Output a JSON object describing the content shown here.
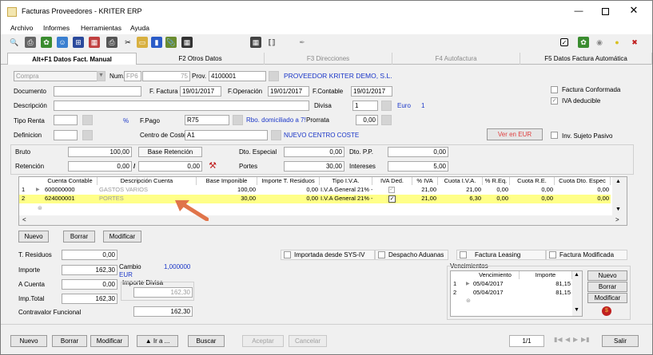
{
  "window": {
    "title": "Facturas Proveedores - KRITER ERP"
  },
  "menu": [
    "Archivo",
    "Informes",
    "Herramientas",
    "Ayuda"
  ],
  "tabs": [
    "Alt+F1 Datos Fact. Manual",
    "F2 Otros Datos",
    "F3 Direcciones",
    "F4 Autofactura",
    "F5 Datos Factura Automática"
  ],
  "header": {
    "tipo": "Compra",
    "num_label": "Num.",
    "num_serie": "FP6",
    "num_value": "75",
    "prov_label": "Prov.",
    "prov_code": "4100001",
    "prov_name": "PROVEEDOR KRITER DEMO, S.L.",
    "documento_label": "Documento",
    "f_factura_label": "F. Factura",
    "f_factura": "19/01/2017",
    "f_operacion_label": "F.Operación",
    "f_operacion": "19/01/2017",
    "f_contable_label": "F.Contable",
    "f_contable": "19/01/2017",
    "descripcion_label": "Descripción",
    "divisa_label": "Divisa",
    "divisa_value": "1",
    "divisa_name": "Euro",
    "divisa_rate": "1",
    "tipo_renta_label": "Tipo Renta",
    "pct": "%",
    "fpago_label": "F.Pago",
    "fpago_code": "R75",
    "fpago_name": "Rbo. domiciliado a 75 días",
    "prorrata_label": "Prorrata",
    "prorrata_value": "0,00",
    "definicion_label": "Definicion",
    "centro_label": "Centro de Coste",
    "centro_code": "A1",
    "centro_name": "NUEVO CENTRO COSTE",
    "ver_eur_button": "Ver en EUR",
    "factura_conformada": "Factura Conformada",
    "iva_deducible": "IVA deducible",
    "inv_sujeto_pasivo": "Inv. Sujeto Pasivo"
  },
  "totals": {
    "bruto_label": "Bruto",
    "bruto": "100,00",
    "base_retencion_label": "Base Retención",
    "retencion_label": "Retención",
    "retencion_pct": "0,00",
    "retencion_base": "0,00",
    "dto_especial_label": "Dto. Especial",
    "dto_especial": "0,00",
    "dto_pp_label": "Dto. P.P.",
    "dto_pp": "0,00",
    "portes_label": "Portes",
    "portes": "30,00",
    "intereses_label": "Intereses",
    "intereses": "5,00"
  },
  "lines_grid": {
    "columns": [
      "Cuenta Contable",
      "Descripción Cuenta",
      "Base Imponible",
      "Importe T. Residuos",
      "Tipo I.V.A.",
      "IVA Ded.",
      "% IVA",
      "Cuota I.V.A.",
      "% R.Eq.",
      "Cuota R.E.",
      "Cuota Dto. Espec"
    ],
    "rows": [
      {
        "n": "1",
        "cuenta": "600000000",
        "desc": "GASTOS VARIOS",
        "base": "100,00",
        "residuos": "0,00",
        "tipo": "I.V.A General 21% -",
        "pct_iva": "21,00",
        "cuota_iva": "21,00",
        "pct_req": "0,00",
        "cuota_re": "0,00",
        "dto": "0,00"
      },
      {
        "n": "2",
        "cuenta": "624000001",
        "desc": "PORTES",
        "base": "30,00",
        "residuos": "0,00",
        "tipo": "I.V.A General 21% -",
        "pct_iva": "21,00",
        "cuota_iva": "6,30",
        "pct_req": "0,00",
        "cuota_re": "0,00",
        "dto": "0,00"
      }
    ]
  },
  "line_buttons": {
    "nuevo": "Nuevo",
    "borrar": "Borrar",
    "modificar": "Modificar"
  },
  "summary": {
    "t_residuos_label": "T. Residuos",
    "t_residuos": "0,00",
    "importe_label": "Importe",
    "importe": "162,30",
    "cambio_label": "Cambio",
    "cambio": "1,000000",
    "cambio_currency": "EUR",
    "importe_divisa_label": "Importe Divisa",
    "importe_divisa": "162,30",
    "a_cuenta_label": "A Cuenta",
    "a_cuenta": "0,00",
    "imp_total_label": "Imp.Total",
    "imp_total": "162,30",
    "contravalor_label": "Contravalor Funcional",
    "contravalor": "162,30"
  },
  "flags": [
    "Importada desde SYS-IV",
    "Despacho Aduanas",
    "Factura Leasing",
    "Factura Modificada"
  ],
  "vencimientos": {
    "title": "Vencimientos",
    "columns": [
      "Vencimiento",
      "Importe"
    ],
    "rows": [
      {
        "n": "1",
        "fecha": "05/04/2017",
        "importe": "81,15"
      },
      {
        "n": "2",
        "fecha": "05/04/2017",
        "importe": "81,15"
      }
    ],
    "buttons": [
      "Nuevo",
      "Borrar",
      "Modificar"
    ]
  },
  "bottom": {
    "nuevo": "Nuevo",
    "borrar": "Borrar",
    "modificar": "Modificar",
    "ira": "Ir a ...",
    "buscar": "Buscar",
    "aceptar": "Aceptar",
    "cancelar": "Cancelar",
    "pager": "1/1",
    "salir": "Salir"
  },
  "colors": {
    "accent_blue": "#1a36c8",
    "row_highlight": "#ffff88",
    "ver_eur": "#e04040",
    "arrow": "#e0744a"
  }
}
